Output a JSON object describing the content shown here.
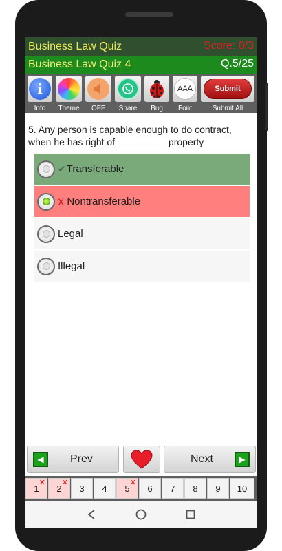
{
  "header": {
    "app_title": "Business Law Quiz",
    "score": "Score: 0/3",
    "quiz_name": "Business Law Quiz 4",
    "question_counter": "Q.5/25"
  },
  "toolbar": {
    "info_label": "Info",
    "theme_label": "Theme",
    "sound_label": "OFF",
    "share_label": "Share",
    "bug_label": "Bug",
    "font_label": "Font",
    "font_icon_text": "AAA",
    "submit_button_text": "Submit",
    "submit_all_label": "Submit All"
  },
  "question": {
    "text": "5. Any person is capable enough to do contract, when he has right of _________ property"
  },
  "options": [
    {
      "text": "Transferable",
      "state": "correct",
      "mark": "✔",
      "selected": false
    },
    {
      "text": "Nontransferable",
      "state": "wrong",
      "mark": "X",
      "selected": true
    },
    {
      "text": "Legal",
      "state": "none",
      "mark": "",
      "selected": false
    },
    {
      "text": "Illegal",
      "state": "none",
      "mark": "",
      "selected": false
    }
  ],
  "nav": {
    "prev_label": "Prev",
    "next_label": "Next"
  },
  "question_strip": [
    {
      "num": "1",
      "wrong": true
    },
    {
      "num": "2",
      "wrong": true
    },
    {
      "num": "3",
      "wrong": false
    },
    {
      "num": "4",
      "wrong": false
    },
    {
      "num": "5",
      "wrong": true
    },
    {
      "num": "6",
      "wrong": false
    },
    {
      "num": "7",
      "wrong": false
    },
    {
      "num": "8",
      "wrong": false
    },
    {
      "num": "9",
      "wrong": false
    },
    {
      "num": "10",
      "wrong": false
    }
  ],
  "colors": {
    "header_dark": "#2f4f2f",
    "header_green": "#1d8a1d",
    "correct_bg": "#7aaa7a",
    "wrong_bg": "#ff7f7f",
    "score_red": "#e02020"
  }
}
